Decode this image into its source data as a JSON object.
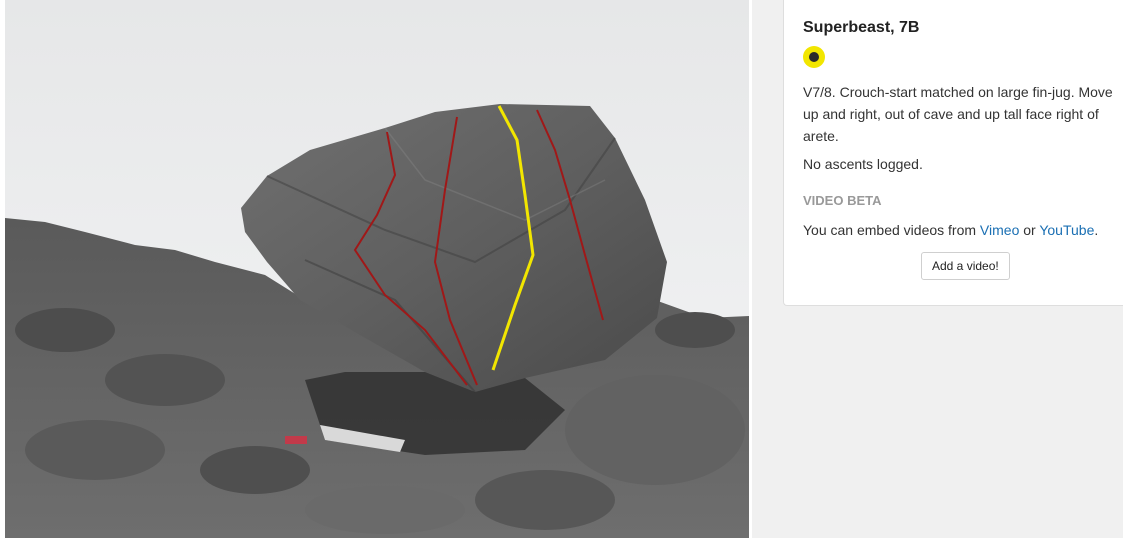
{
  "problem": {
    "title": "Superbeast, 7B",
    "grade_color": "#f2e600",
    "grade_icon": "grade-circle-icon",
    "description": "V7/8. Crouch-start matched on large fin-jug. Move up and right, out of cave and up tall face right of arete.",
    "ascents_text": "No ascents logged."
  },
  "video": {
    "heading": "VIDEO BETA",
    "embed_prefix": "You can embed videos from ",
    "vimeo_label": "Vimeo",
    "or_text": " or ",
    "youtube_label": "YouTube",
    "suffix": ".",
    "add_button_label": "Add a video!"
  },
  "topo": {
    "highlight_line_color": "#f2e600",
    "other_line_color": "#a01818"
  }
}
